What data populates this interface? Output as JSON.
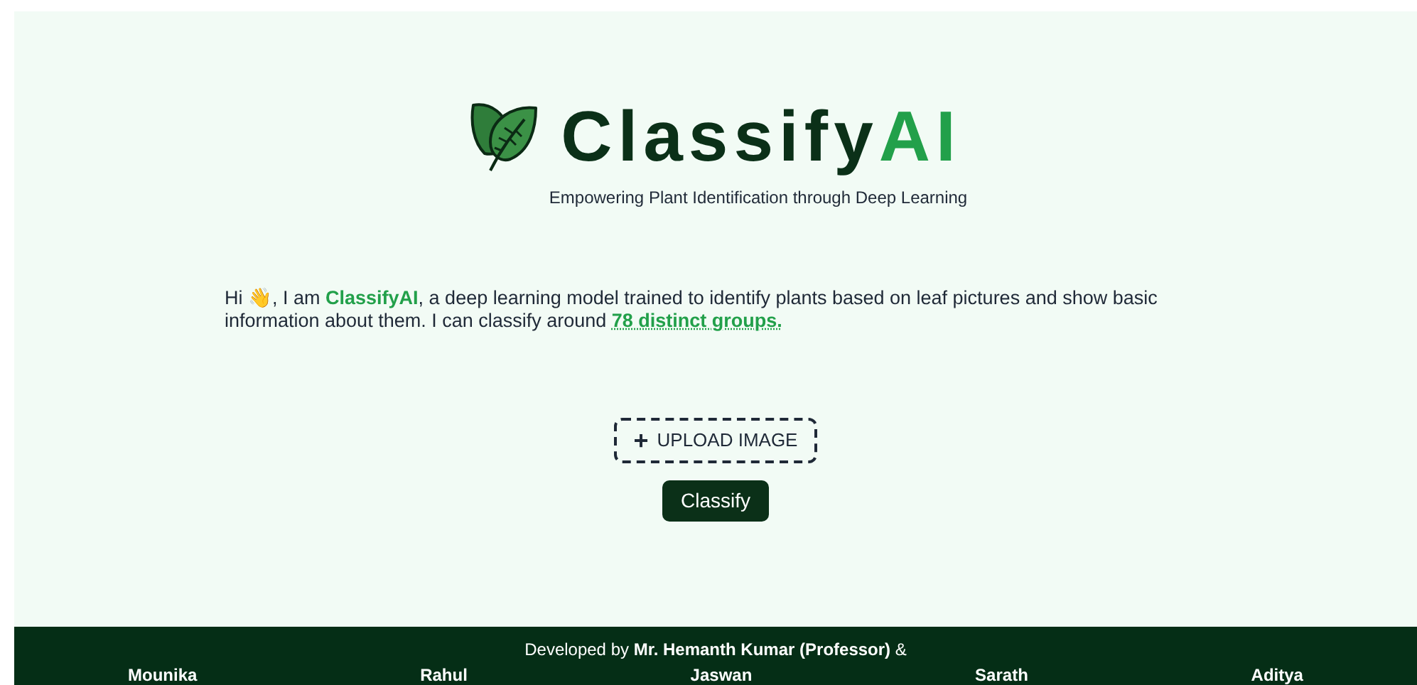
{
  "brand": {
    "name_main": "Classify",
    "name_accent": "AI",
    "tagline": "Empowering Plant Identification through Deep Learning"
  },
  "intro": {
    "before": "Hi 👋, I am ",
    "highlight": "ClassifyAI",
    "after": ", a deep learning model trained to identify plants based on leaf pictures and show basic information about them. I can classify around ",
    "link": "78 distinct groups."
  },
  "upload_button": {
    "icon": "+",
    "label": "UPLOAD IMAGE"
  },
  "classify_button": {
    "label": "Classify"
  },
  "footer": {
    "credit": "Developed by **Mr. Hemanth Kumar (Professor)** &",
    "members": [
      "Mounika",
      "Rahul",
      "Jaswan",
      "Sarath",
      "Aditya"
    ]
  }
}
